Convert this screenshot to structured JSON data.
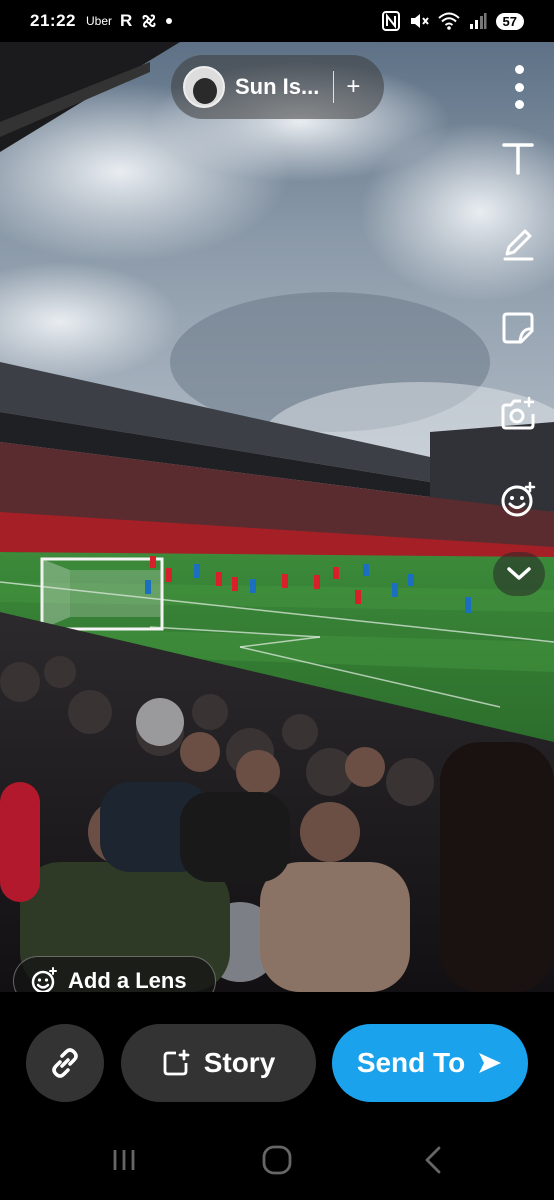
{
  "status_bar": {
    "time": "21:22",
    "app_text": "Uber",
    "app_r": "R",
    "battery": "57",
    "icons": [
      "nfc-icon",
      "mute-icon",
      "wifi-icon",
      "signal-icon",
      "battery-icon"
    ]
  },
  "story_chip": {
    "title": "Sun Is...",
    "add_symbol": "+"
  },
  "toolbar": {
    "items": [
      "more-options",
      "text-tool",
      "pen-tool",
      "sticker-tool",
      "camera-lens-tool",
      "emoji-tool",
      "expand-chevron"
    ]
  },
  "lens_button": {
    "label": "Add a Lens"
  },
  "actions": {
    "story_label": "Story",
    "send_label": "Send To"
  },
  "colors": {
    "send_blue": "#1aa3ec",
    "button_gray": "#333333"
  },
  "nav": {
    "items": [
      "recent-apps-icon",
      "home-icon",
      "back-icon"
    ]
  }
}
